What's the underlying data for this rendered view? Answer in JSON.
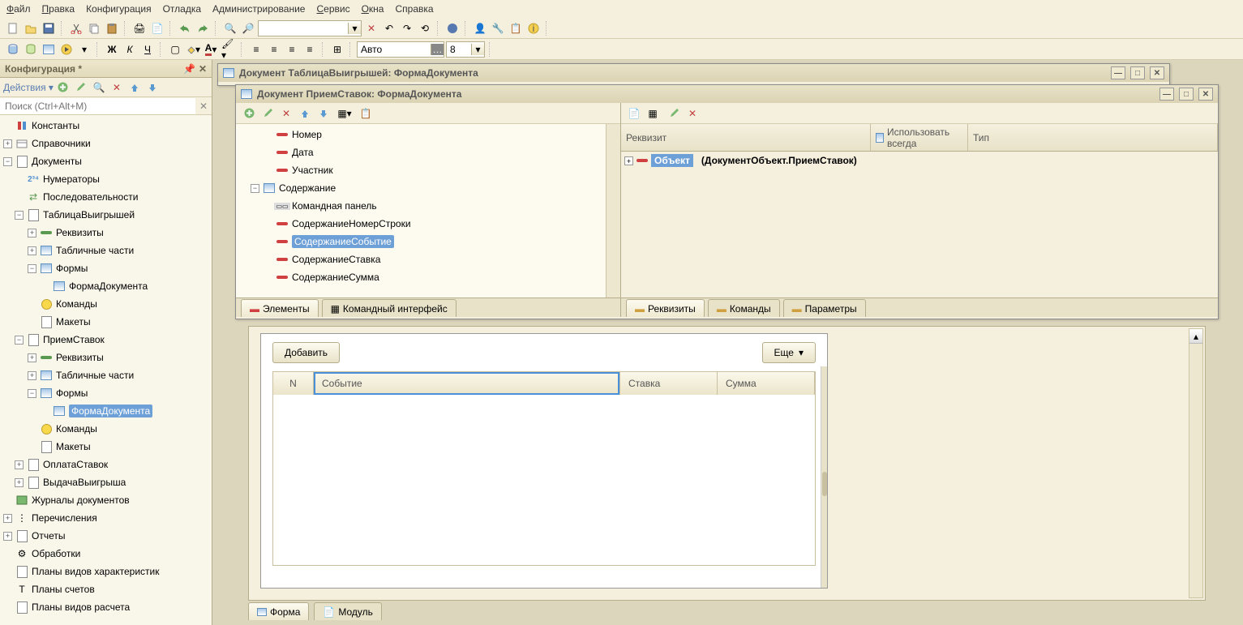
{
  "menu": {
    "file": "Файл",
    "edit": "Правка",
    "config": "Конфигурация",
    "debug": "Отладка",
    "admin": "Администрирование",
    "service": "Сервис",
    "windows": "Окна",
    "help": "Справка"
  },
  "toolbar2": {
    "font_size": "8",
    "auto": "Авто"
  },
  "sidebar": {
    "title": "Конфигурация *",
    "actions": "Действия",
    "search_placeholder": "Поиск (Ctrl+Alt+M)",
    "items": [
      {
        "text": "Константы",
        "lvl": 0,
        "ico": "const"
      },
      {
        "text": "Справочники",
        "lvl": 0,
        "exp": "+",
        "ico": "ref"
      },
      {
        "text": "Документы",
        "lvl": 0,
        "exp": "-",
        "ico": "doc"
      },
      {
        "text": "Нумераторы",
        "lvl": 1,
        "ico": "num"
      },
      {
        "text": "Последовательности",
        "lvl": 1,
        "ico": "seq"
      },
      {
        "text": "ТаблицаВыигрышей",
        "lvl": 1,
        "exp": "-",
        "ico": "doc"
      },
      {
        "text": "Реквизиты",
        "lvl": 2,
        "exp": "+",
        "ico": "attr"
      },
      {
        "text": "Табличные части",
        "lvl": 2,
        "exp": "+",
        "ico": "tab"
      },
      {
        "text": "Формы",
        "lvl": 2,
        "exp": "-",
        "ico": "form"
      },
      {
        "text": "ФормаДокумента",
        "lvl": 3,
        "ico": "form"
      },
      {
        "text": "Команды",
        "lvl": 2,
        "ico": "cmd"
      },
      {
        "text": "Макеты",
        "lvl": 2,
        "ico": "tmpl"
      },
      {
        "text": "ПриемСтавок",
        "lvl": 1,
        "exp": "-",
        "ico": "doc"
      },
      {
        "text": "Реквизиты",
        "lvl": 2,
        "exp": "+",
        "ico": "attr"
      },
      {
        "text": "Табличные части",
        "lvl": 2,
        "exp": "+",
        "ico": "tab"
      },
      {
        "text": "Формы",
        "lvl": 2,
        "exp": "-",
        "ico": "form"
      },
      {
        "text": "ФормаДокумента",
        "lvl": 3,
        "ico": "form",
        "sel": true
      },
      {
        "text": "Команды",
        "lvl": 2,
        "ico": "cmd"
      },
      {
        "text": "Макеты",
        "lvl": 2,
        "ico": "tmpl"
      },
      {
        "text": "ОплатаСтавок",
        "lvl": 1,
        "exp": "+",
        "ico": "doc"
      },
      {
        "text": "ВыдачаВыигрыша",
        "lvl": 1,
        "exp": "+",
        "ico": "doc"
      },
      {
        "text": "Журналы документов",
        "lvl": 0,
        "ico": "jrn"
      },
      {
        "text": "Перечисления",
        "lvl": 0,
        "exp": "+",
        "ico": "enum"
      },
      {
        "text": "Отчеты",
        "lvl": 0,
        "exp": "+",
        "ico": "rpt"
      },
      {
        "text": "Обработки",
        "lvl": 0,
        "ico": "proc"
      },
      {
        "text": "Планы видов характеристик",
        "lvl": 0,
        "ico": "plan"
      },
      {
        "text": "Планы счетов",
        "lvl": 0,
        "ico": "acct"
      },
      {
        "text": "Планы видов расчета",
        "lvl": 0,
        "ico": "calc"
      }
    ]
  },
  "win1": {
    "title": "Документ ТаблицаВыигрышей: ФормаДокумента"
  },
  "win2": {
    "title": "Документ ПриемСтавок: ФормаДокумента",
    "elements": [
      {
        "text": "Номер",
        "lvl": 1,
        "ico": "bar"
      },
      {
        "text": "Дата",
        "lvl": 1,
        "ico": "bar"
      },
      {
        "text": "Участник",
        "lvl": 1,
        "ico": "bar"
      },
      {
        "text": "Содержание",
        "lvl": 0,
        "exp": "-",
        "ico": "table"
      },
      {
        "text": "Командная панель",
        "lvl": 1,
        "ico": "cmdpanel"
      },
      {
        "text": "СодержаниеНомерСтроки",
        "lvl": 1,
        "ico": "bar"
      },
      {
        "text": "СодержаниеСобытие",
        "lvl": 1,
        "ico": "bar",
        "sel": true
      },
      {
        "text": "СодержаниеСтавка",
        "lvl": 1,
        "ico": "bar"
      },
      {
        "text": "СодержаниеСумма",
        "lvl": 1,
        "ico": "bar"
      }
    ],
    "left_tabs": {
      "t1": "Элементы",
      "t2": "Командный интерфейс"
    },
    "right_tabs": {
      "t1": "Реквизиты",
      "t2": "Команды",
      "t3": "Параметры"
    },
    "attr_cols": {
      "c1": "Реквизит",
      "c2": "Использовать всегда",
      "c3": "Тип"
    },
    "obj": "Объект",
    "obj_type": "(ДокументОбъект.ПриемСтавок)"
  },
  "preview": {
    "add": "Добавить",
    "more": "Еще",
    "cols": {
      "n": "N",
      "evt": "Событие",
      "bet": "Ставка",
      "sum": "Сумма"
    }
  },
  "bottom_tabs": {
    "t1": "Форма",
    "t2": "Модуль"
  }
}
